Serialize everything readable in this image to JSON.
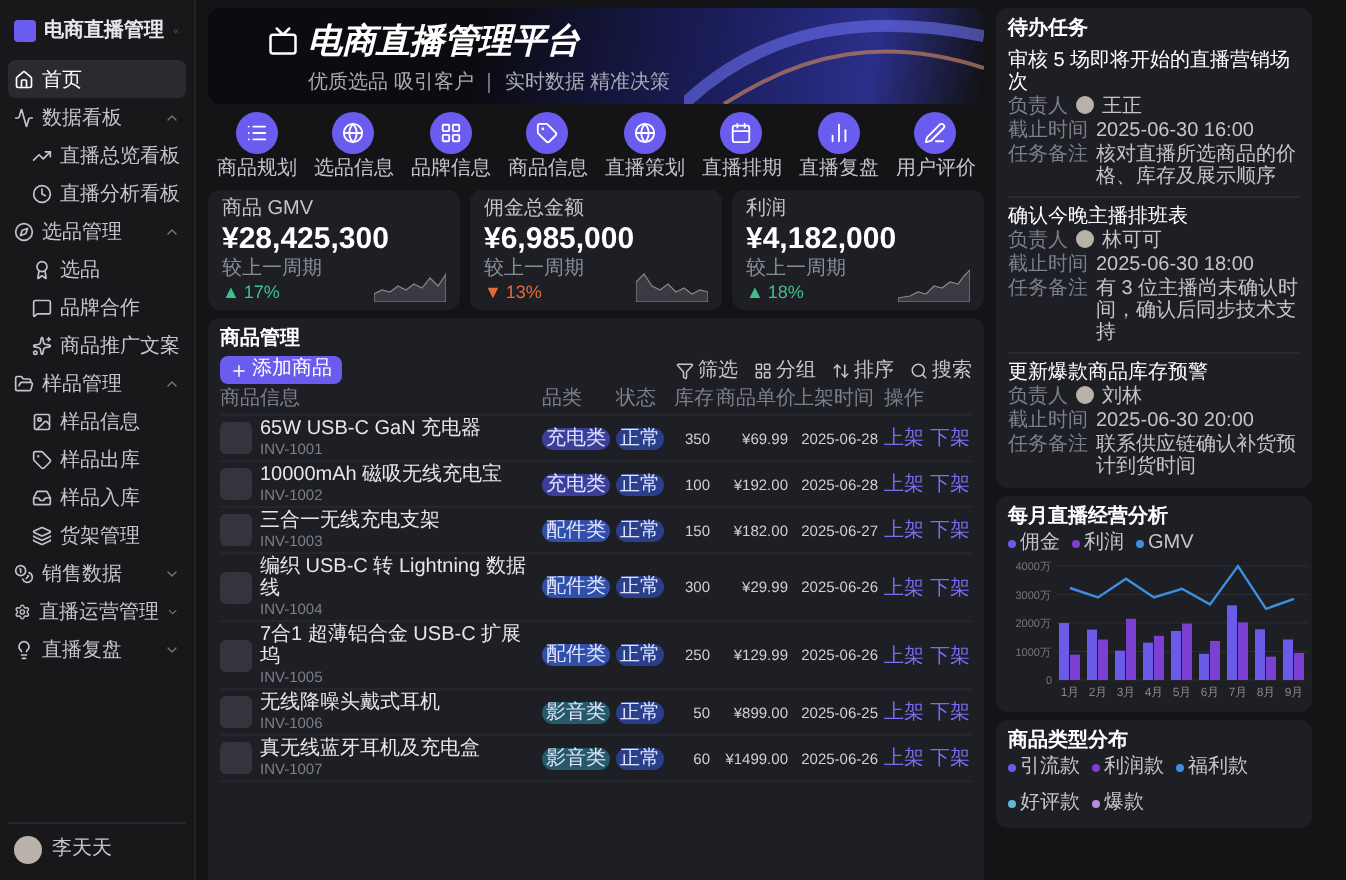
{
  "sidebar": {
    "brand": "电商直播管理",
    "items": [
      {
        "kind": "link",
        "label": "首页",
        "selected": true
      },
      {
        "kind": "group",
        "label": "数据看板",
        "selected": false,
        "expanded": true,
        "children": [
          {
            "label": "直播总览看板",
            "selected": false
          },
          {
            "label": "直播分析看板",
            "selected": false
          }
        ]
      },
      {
        "kind": "group",
        "label": "选品管理",
        "selected": false,
        "expanded": true,
        "children": [
          {
            "label": "选品",
            "selected": false
          },
          {
            "label": "品牌合作",
            "selected": false
          },
          {
            "label": "商品推广文案",
            "selected": false
          }
        ]
      },
      {
        "kind": "group",
        "label": "样品管理",
        "selected": false,
        "expanded": true,
        "children": [
          {
            "label": "样品信息",
            "selected": false
          },
          {
            "label": "样品出库",
            "selected": false
          },
          {
            "label": "样品入库",
            "selected": false
          },
          {
            "label": "货架管理",
            "selected": false
          }
        ]
      },
      {
        "kind": "group",
        "label": "销售数据",
        "selected": false,
        "expanded": false
      },
      {
        "kind": "group",
        "label": "直播运营管理",
        "selected": false,
        "expanded": false
      },
      {
        "kind": "group",
        "label": "直播复盘",
        "selected": false,
        "expanded": false
      }
    ],
    "user": {
      "name": "李天天"
    }
  },
  "banner": {
    "title": "电商直播管理平台",
    "subtitle": "优质选品 吸引客户 ｜ 实时数据 精准决策"
  },
  "shortcuts": [
    "商品规划",
    "选品信息",
    "品牌信息",
    "商品信息",
    "直播策划",
    "直播排期",
    "直播复盘",
    "用户评价"
  ],
  "stats": [
    {
      "label": "商品 GMV",
      "value": "¥28,425,300",
      "compare": "较上一周期",
      "arrow": "▲",
      "change": "17%",
      "color": "#3fbf8a"
    },
    {
      "label": "佣金总金额",
      "value": "¥6,985,000",
      "compare": "较上一周期",
      "arrow": "▼",
      "change": "13%",
      "color": "#e56a3a"
    },
    {
      "label": "利润",
      "value": "¥4,182,000",
      "compare": "较上一周期",
      "arrow": "▲",
      "change": "18%",
      "color": "#3fbf8a"
    }
  ],
  "products": {
    "title": "商品管理",
    "add_button": "添加商品",
    "tools": [
      "筛选",
      "分组",
      "排序",
      "搜索"
    ],
    "columns": [
      "商品信息",
      "品类",
      "状态",
      "库存",
      "商品单价",
      "上架时间",
      "操作"
    ],
    "rows": [
      {
        "name": "65W USB-C GaN 充电器",
        "sku": "INV-1001",
        "category": "充电类",
        "color": "#3c3f9a",
        "status": "正常",
        "stock": "350",
        "price": "¥69.99",
        "date": "2025-06-28",
        "actions": [
          "上架",
          "下架"
        ]
      },
      {
        "name": "10000mAh 磁吸无线充电宝",
        "sku": "INV-1002",
        "category": "充电类",
        "color": "#3c3f9a",
        "status": "正常",
        "stock": "100",
        "price": "¥192.00",
        "date": "2025-06-28",
        "actions": [
          "上架",
          "下架"
        ]
      },
      {
        "name": "三合一无线充电支架",
        "sku": "INV-1003",
        "category": "配件类",
        "color": "#2f4fa8",
        "status": "正常",
        "stock": "150",
        "price": "¥182.00",
        "date": "2025-06-27",
        "actions": [
          "上架",
          "下架"
        ]
      },
      {
        "name": "编织 USB-C 转 Lightning 数据线",
        "sku": "INV-1004",
        "category": "配件类",
        "color": "#2f4fa8",
        "status": "正常",
        "stock": "300",
        "price": "¥29.99",
        "date": "2025-06-26",
        "actions": [
          "上架",
          "下架"
        ]
      },
      {
        "name": "7合1 超薄铝合金 USB-C 扩展坞",
        "sku": "INV-1005",
        "category": "配件类",
        "color": "#2f4fa8",
        "status": "正常",
        "stock": "250",
        "price": "¥129.99",
        "date": "2025-06-26",
        "actions": [
          "上架",
          "下架"
        ]
      },
      {
        "name": "无线降噪头戴式耳机",
        "sku": "INV-1006",
        "category": "影音类",
        "color": "#255a66",
        "status": "正常",
        "stock": "50",
        "price": "¥899.00",
        "date": "2025-06-25",
        "actions": [
          "上架",
          "下架"
        ]
      },
      {
        "name": "真无线蓝牙耳机及充电盒",
        "sku": "INV-1007",
        "category": "影音类",
        "color": "#255a66",
        "status": "正常",
        "stock": "60",
        "price": "¥1499.00",
        "date": "2025-06-26",
        "actions": [
          "上架",
          "下架"
        ]
      }
    ]
  },
  "tasks": {
    "title": "待办任务",
    "items": [
      {
        "title": "审核 5 场即将开始的直播营销场次",
        "owner_label": "负责人",
        "owner": "王正",
        "due_label": "截止时间",
        "due": "2025-06-30 16:00",
        "note_label": "任务备注",
        "note": "核对直播所选商品的价格、库存及展示顺序"
      },
      {
        "title": "确认今晚主播排班表",
        "owner_label": "负责人",
        "owner": "林可可",
        "due_label": "截止时间",
        "due": "2025-06-30 18:00",
        "note_label": "任务备注",
        "note": "有 3 位主播尚未确认时间，确认后同步技术支持"
      },
      {
        "title": "更新爆款商品库存预警",
        "owner_label": "负责人",
        "owner": "刘林",
        "due_label": "截止时间",
        "due": "2025-06-30 20:00",
        "note_label": "任务备注",
        "note": "联系供应链确认补货预计到货时间"
      }
    ]
  },
  "analysis": {
    "chart_data": {
      "type": "bar",
      "title": "每月直播经营分析",
      "categories": [
        "1月",
        "2月",
        "3月",
        "4月",
        "5月",
        "6月",
        "7月",
        "8月",
        "9月"
      ],
      "grid": true,
      "series": [
        {
          "name": "佣金",
          "type": "bar",
          "color": "#6a5be8",
          "values": [
            2000,
            1770,
            1030,
            1310,
            1720,
            920,
            2620,
            1780,
            1420
          ]
        },
        {
          "name": "利润",
          "type": "bar",
          "color": "#7b3fd1",
          "values": [
            890,
            1420,
            2150,
            1550,
            1980,
            1370,
            2020,
            820,
            950
          ]
        },
        {
          "name": "GMV",
          "type": "line",
          "color": "#3d8fe0",
          "values": [
            3230,
            2900,
            3550,
            2900,
            3200,
            2650,
            4000,
            2500,
            2850
          ]
        }
      ],
      "ylim": [
        0,
        4000
      ],
      "yticks": [
        {
          "value": 0,
          "label": "0"
        },
        {
          "value": 1000,
          "label": "1000万"
        },
        {
          "value": 2000,
          "label": "2000万"
        },
        {
          "value": 3000,
          "label": "3000万"
        },
        {
          "value": 4000,
          "label": "4000万"
        }
      ]
    }
  },
  "categories_panel": {
    "title": "商品类型分布",
    "legend": [
      {
        "label": "引流款",
        "color": "#6a5be8"
      },
      {
        "label": "利润款",
        "color": "#7b3fd1"
      },
      {
        "label": "福利款",
        "color": "#3d8fe0"
      },
      {
        "label": "好评款",
        "color": "#5fb8d8"
      },
      {
        "label": "爆款",
        "color": "#b48de0"
      }
    ]
  }
}
